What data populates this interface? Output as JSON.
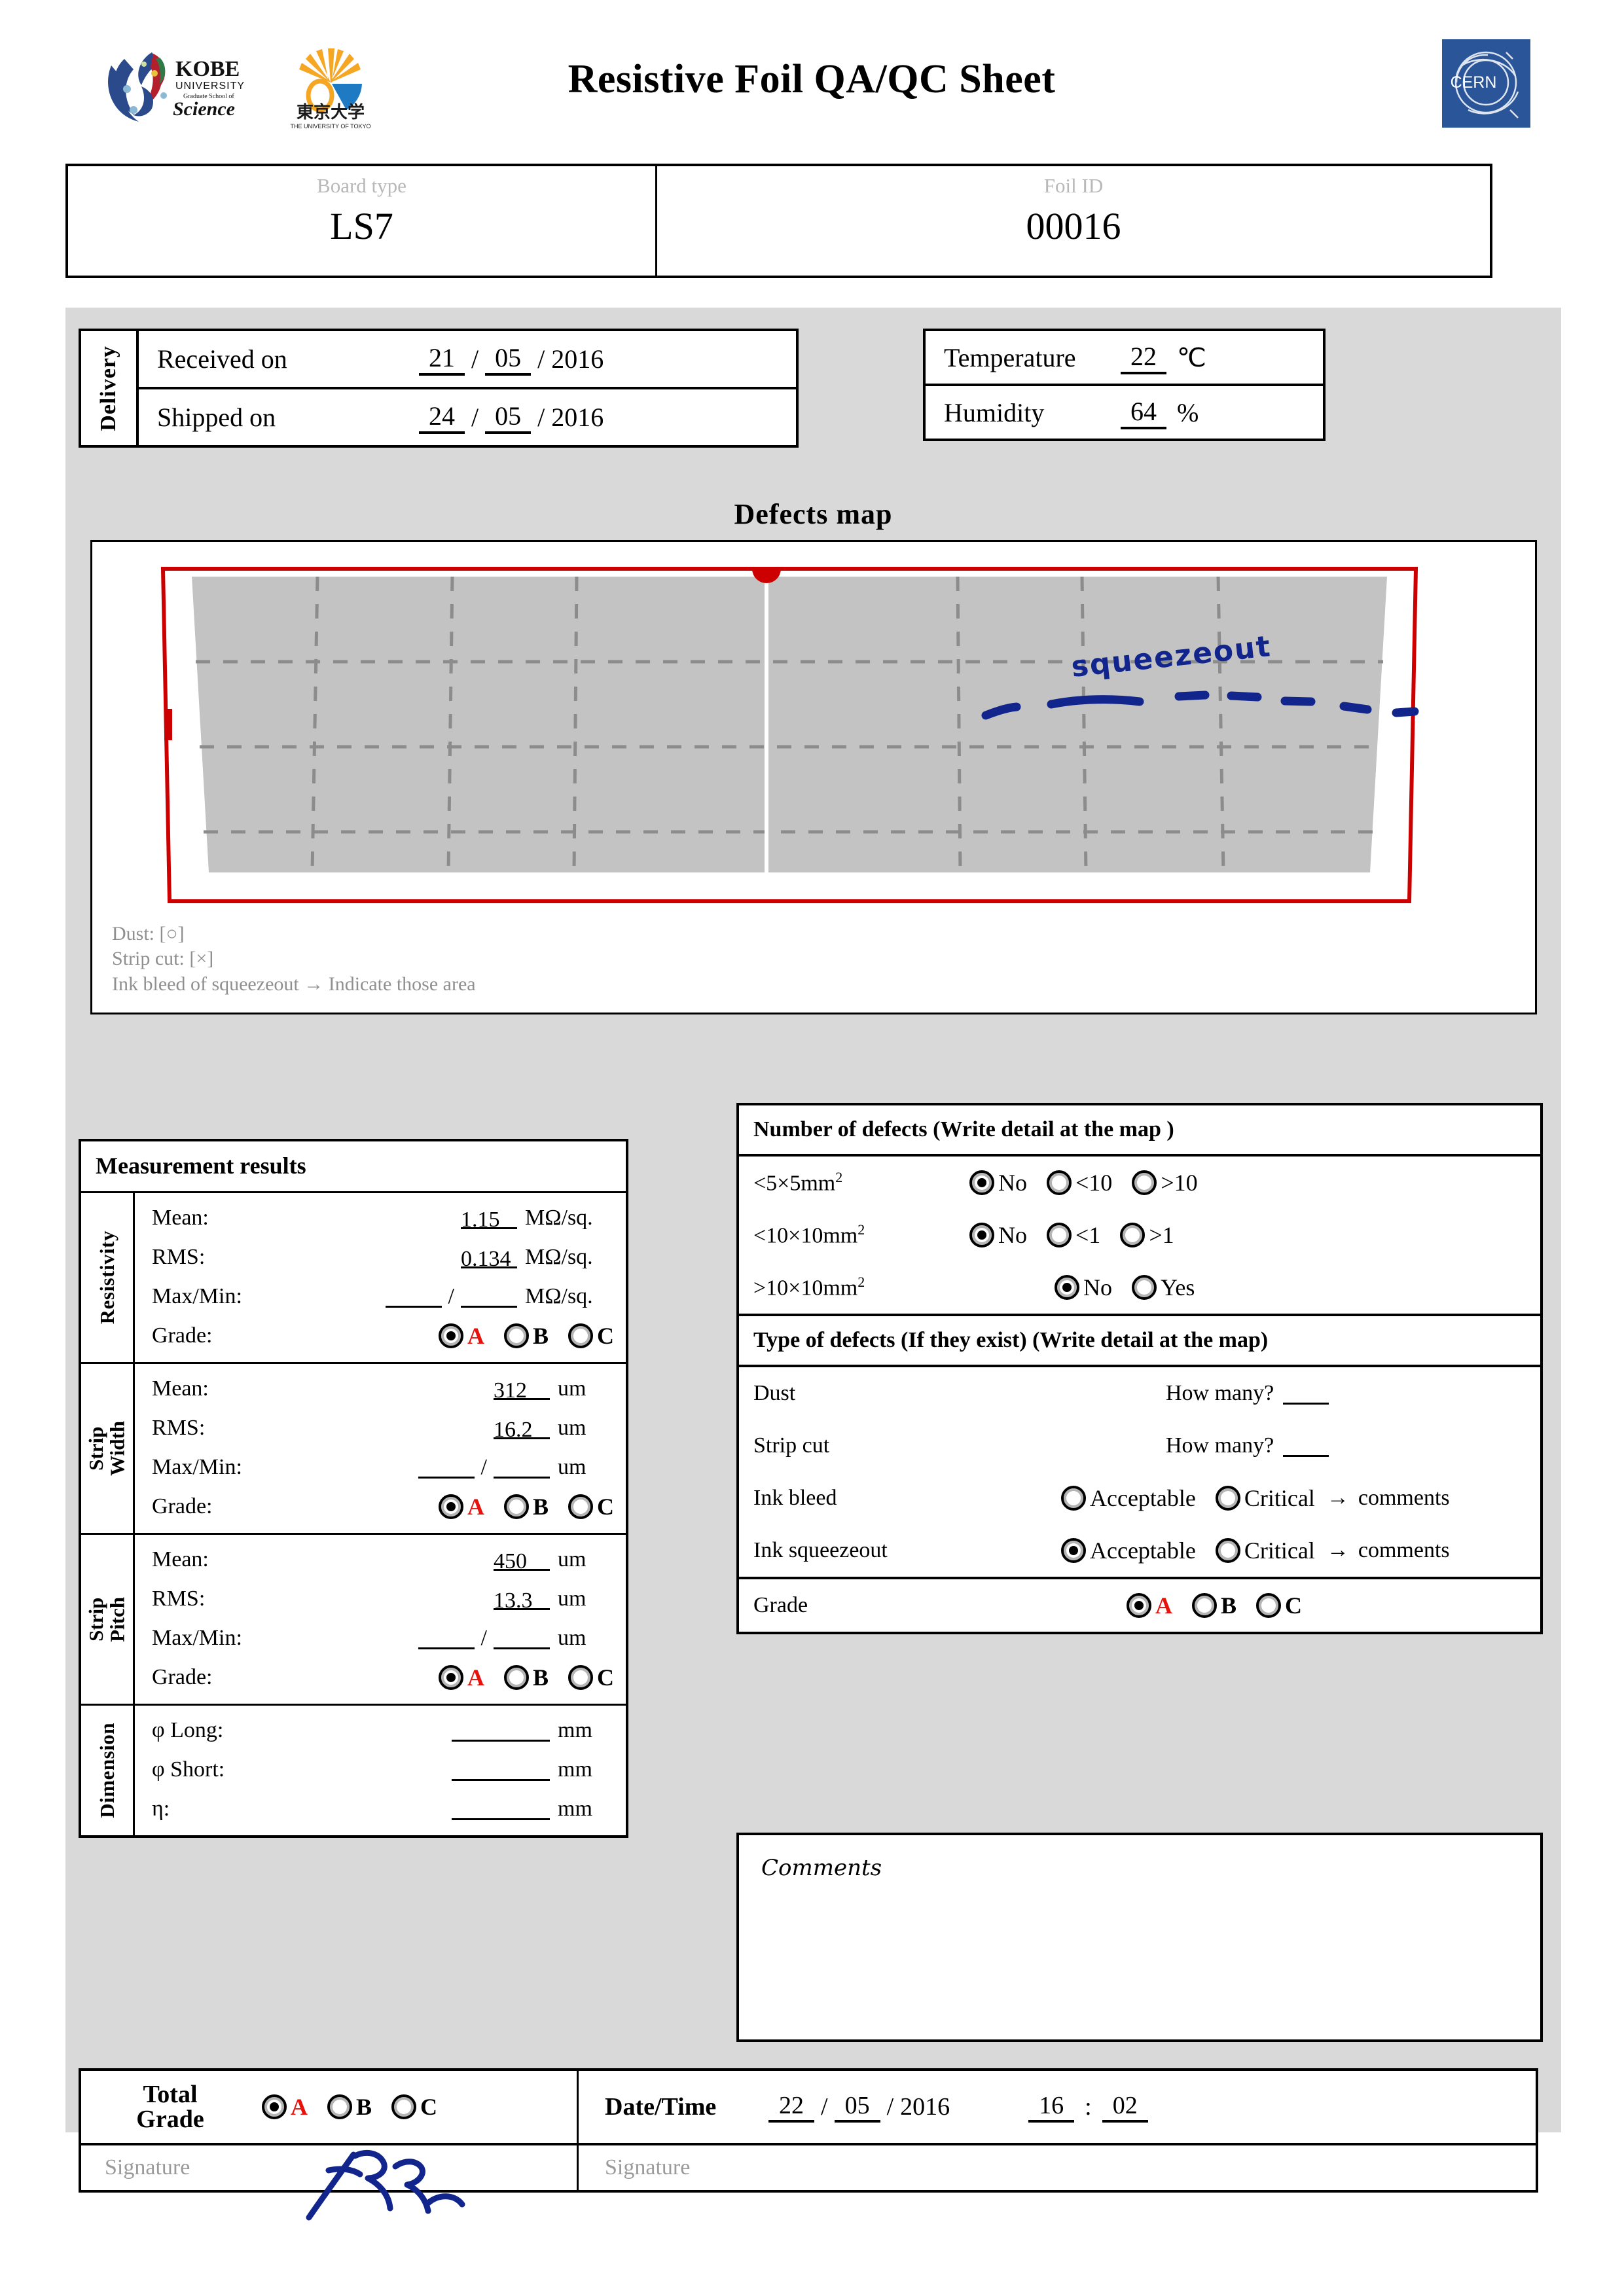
{
  "header": {
    "title": "Resistive Foil QA/QC Sheet",
    "logos": [
      {
        "name": "kobe-university-logo",
        "text": "KOBE UNIVERSITY Graduate School of Science"
      },
      {
        "name": "university-of-tokyo-logo",
        "text": "東京大学 THE UNIVERSITY OF TOKYO"
      },
      {
        "name": "cern-logo",
        "text": "CERN"
      }
    ]
  },
  "identification": {
    "board_type_label": "Board type",
    "board_type_value": "LS7",
    "foil_id_label": "Foil ID",
    "foil_id_value": "00016"
  },
  "delivery": {
    "section_label": "Delivery",
    "received_label": "Received on",
    "received_day": "21",
    "received_month": "05",
    "received_year": "2016",
    "shipped_label": "Shipped on",
    "shipped_day": "24",
    "shipped_month": "05",
    "shipped_year": "2016"
  },
  "environment": {
    "temperature_label": "Temperature",
    "temperature_value": "22",
    "temperature_unit": "℃",
    "humidity_label": "Humidity",
    "humidity_value": "64",
    "humidity_unit": "%"
  },
  "defects_map": {
    "title": "Defects map",
    "legend_dust": "Dust: [○]",
    "legend_strip_cut": "Strip cut: [×]",
    "legend_ink": "Ink bleed of squeezeout  →  Indicate those area",
    "annotation_text": "squeezeout",
    "annotation_color": "#11258c",
    "outline_color": "#cc0000",
    "foil_fill_color": "#c3c3c3"
  },
  "measurement": {
    "heading": "Measurement results",
    "groups": [
      {
        "name": "Resistivity",
        "name_lines": [
          "Resistivity"
        ],
        "mean_label": "Mean:",
        "mean_value": "1.15",
        "rms_label": "RMS:",
        "rms_value": "0.134",
        "maxmin_label": "Max/Min:",
        "max_value": "",
        "min_value": "",
        "unit": "MΩ/sq.",
        "grade_label": "Grade:",
        "grade_selected": "A"
      },
      {
        "name": "Strip Width",
        "name_lines": [
          "Strip",
          "Width"
        ],
        "mean_label": "Mean:",
        "mean_value": "312",
        "rms_label": "RMS:",
        "rms_value": "16.2",
        "maxmin_label": "Max/Min:",
        "max_value": "",
        "min_value": "",
        "unit": "um",
        "grade_label": "Grade:",
        "grade_selected": "A"
      },
      {
        "name": "Strip Pitch",
        "name_lines": [
          "Strip",
          "Pitch"
        ],
        "mean_label": "Mean:",
        "mean_value": "450",
        "rms_label": "RMS:",
        "rms_value": "13.3",
        "maxmin_label": "Max/Min:",
        "max_value": "",
        "min_value": "",
        "unit": "um",
        "grade_label": "Grade:",
        "grade_selected": "A"
      }
    ],
    "dimension": {
      "name": "Dimension",
      "long_label": "φ Long:",
      "long_value": "",
      "short_label": "φ Short:",
      "short_value": "",
      "eta_label": "η:",
      "eta_value": "",
      "unit": "mm"
    },
    "grade_options": [
      "A",
      "B",
      "C"
    ]
  },
  "number_of_defects": {
    "heading": "Number of defects (Write detail at the map )",
    "rows": [
      {
        "label_pre": "<5×5mm",
        "label_sup": "2",
        "options": [
          "No",
          "<10",
          ">10"
        ],
        "selected": "No"
      },
      {
        "label_pre": "<10×10mm",
        "label_sup": "2",
        "options": [
          "No",
          "<1",
          ">1"
        ],
        "selected": "No"
      },
      {
        "label_pre": ">10×10mm",
        "label_sup": "2",
        "options": [
          "No",
          "Yes"
        ],
        "selected": "No"
      }
    ]
  },
  "type_of_defects": {
    "heading": "Type of defects (If they exist) (Write detail at the map)",
    "dust_label": "Dust",
    "dust_question": "How many?",
    "dust_value": "",
    "stripcut_label": "Strip cut",
    "stripcut_question": "How many?",
    "stripcut_value": "",
    "inkbleed_label": "Ink bleed",
    "inkbleed_options": [
      "Acceptable",
      "Critical"
    ],
    "inkbleed_selected": "",
    "inkbleed_note": "comments",
    "squeezeout_label": "Ink squeezeout",
    "squeezeout_options": [
      "Acceptable",
      "Critical"
    ],
    "squeezeout_selected": "Acceptable",
    "squeezeout_note": "comments",
    "grade_label": "Grade",
    "grade_options": [
      "A",
      "B",
      "C"
    ],
    "grade_selected": "A"
  },
  "comments": {
    "label": "Comments",
    "value": ""
  },
  "footer": {
    "total_grade_line1": "Total",
    "total_grade_line2": "Grade",
    "total_grade_options": [
      "A",
      "B",
      "C"
    ],
    "total_grade_selected": "A",
    "datetime_label": "Date/Time",
    "date_day": "22",
    "date_month": "05",
    "date_year": "2016",
    "time_hour": "16",
    "time_minute": "02",
    "time_separator": ":",
    "signature_label_left": "Signature",
    "signature_label_right": "Signature",
    "signature_present_left": true,
    "signature_present_right": false,
    "signature_ink_color": "#11258c"
  }
}
